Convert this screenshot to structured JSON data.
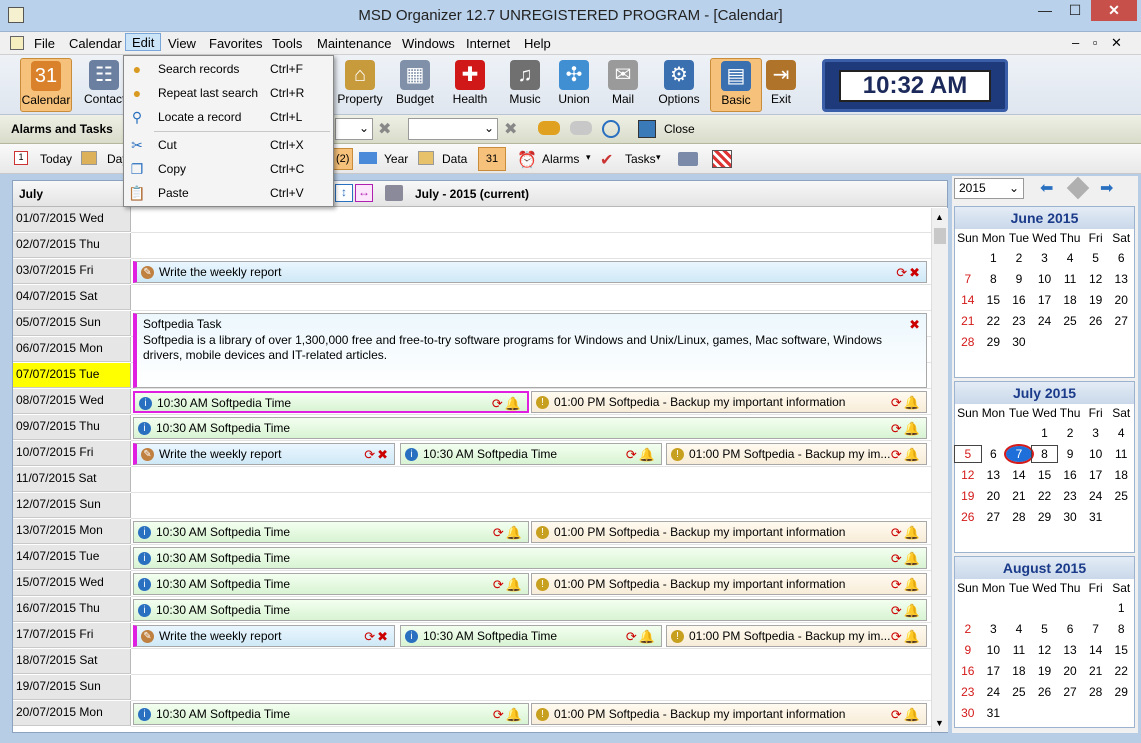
{
  "window": {
    "title": "MSD Organizer 12.7 UNREGISTERED PROGRAM - [Calendar]",
    "minimize": "—",
    "maximize": "☐",
    "close": "✕"
  },
  "menubar": {
    "items": [
      "File",
      "Calendar",
      "Edit",
      "View",
      "Favorites",
      "Tools",
      "Maintenance",
      "Windows",
      "Internet",
      "Help"
    ],
    "active": "Edit",
    "mdi_controls": "– ▫ ✕"
  },
  "edit_menu": [
    {
      "label": "Search records",
      "shortcut": "Ctrl+F",
      "icon": "search-records-icon"
    },
    {
      "label": "Repeat last search",
      "shortcut": "Ctrl+R",
      "icon": "repeat-search-icon"
    },
    {
      "label": "Locate a record",
      "shortcut": "Ctrl+L",
      "icon": "magnifier-icon"
    },
    {
      "label": "Cut",
      "shortcut": "Ctrl+X",
      "icon": "scissors-icon"
    },
    {
      "label": "Copy",
      "shortcut": "Ctrl+C",
      "icon": "copy-icon"
    },
    {
      "label": "Paste",
      "shortcut": "Ctrl+V",
      "icon": "paste-icon"
    }
  ],
  "toolbar": {
    "items": [
      {
        "label": "Calendar",
        "icon": "calendar-icon",
        "color": "#d9822b",
        "glyph": "31"
      },
      {
        "label": "Contacts",
        "icon": "contacts-icon",
        "color": "#6b7fa0",
        "glyph": "☷"
      },
      {
        "label": "Property",
        "icon": "house-icon",
        "color": "#c79a3c",
        "glyph": "⌂"
      },
      {
        "label": "Budget",
        "icon": "calculator-icon",
        "color": "#8090a8",
        "glyph": "▦"
      },
      {
        "label": "Health",
        "icon": "red-cross-icon",
        "color": "#d01818",
        "glyph": "✚"
      },
      {
        "label": "Music",
        "icon": "cd-icon",
        "color": "#707070",
        "glyph": "♫"
      },
      {
        "label": "Union",
        "icon": "puzzle-icon",
        "color": "#3f8fd2",
        "glyph": "✣"
      },
      {
        "label": "Mail",
        "icon": "envelope-icon",
        "color": "#9a9a9a",
        "glyph": "✉"
      },
      {
        "label": "Options",
        "icon": "gears-icon",
        "color": "#3a6fb0",
        "glyph": "⚙"
      },
      {
        "label": "Basic",
        "icon": "basic-view-icon",
        "color": "#3a6fb0",
        "glyph": "▤"
      },
      {
        "label": "Exit",
        "icon": "exit-door-icon",
        "color": "#b0732a",
        "glyph": "⇥"
      }
    ],
    "clock": "10:32 AM"
  },
  "bar2": {
    "section_title": "Alarms and Tasks",
    "close_label": "Close"
  },
  "bar3": {
    "today": "Today",
    "day": "Day",
    "count": "(2)",
    "year": "Year",
    "data": "Data",
    "alarms": "Alarms",
    "tasks": "Tasks"
  },
  "calendar": {
    "month_label": "July",
    "range_label": "July - 2015 (current)"
  },
  "days": [
    {
      "date": "01/07/2015 Wed"
    },
    {
      "date": "02/07/2015 Thu"
    },
    {
      "date": "03/07/2015 Fri"
    },
    {
      "date": "04/07/2015 Sat"
    },
    {
      "date": "05/07/2015 Sun"
    },
    {
      "date": "06/07/2015 Mon"
    },
    {
      "date": "07/07/2015 Tue"
    },
    {
      "date": "08/07/2015 Wed"
    },
    {
      "date": "09/07/2015 Thu"
    },
    {
      "date": "10/07/2015 Fri"
    },
    {
      "date": "11/07/2015 Sat"
    },
    {
      "date": "12/07/2015 Sun"
    },
    {
      "date": "13/07/2015 Mon"
    },
    {
      "date": "14/07/2015 Tue"
    },
    {
      "date": "15/07/2015 Wed"
    },
    {
      "date": "16/07/2015 Thu"
    },
    {
      "date": "17/07/2015 Fri"
    },
    {
      "date": "18/07/2015 Sat"
    },
    {
      "date": "19/07/2015 Sun"
    },
    {
      "date": "20/07/2015 Mon"
    }
  ],
  "events": {
    "weekly": "Write the weekly report",
    "time": "10:30 AM Softpedia Time",
    "backup": "01:00 PM Softpedia - Backup my important information",
    "backup_short": "01:00 PM Softpedia - Backup my im...",
    "task_title": "Softpedia Task",
    "task_body": "Softpedia is a library of over 1,300,000 free and free-to-try software programs for Windows and Unix/Linux, games, Mac software, Windows drivers, mobile devices and IT-related articles."
  },
  "right_panel": {
    "year": "2015",
    "weekdays": [
      "Sun",
      "Mon",
      "Tue",
      "Wed",
      "Thu",
      "Fri",
      "Sat"
    ],
    "months": [
      {
        "name": "June 2015",
        "offset": 1,
        "days": 30
      },
      {
        "name": "July 2015",
        "offset": 3,
        "days": 31,
        "today": 7
      },
      {
        "name": "August 2015",
        "offset": 6,
        "days": 31
      }
    ]
  }
}
